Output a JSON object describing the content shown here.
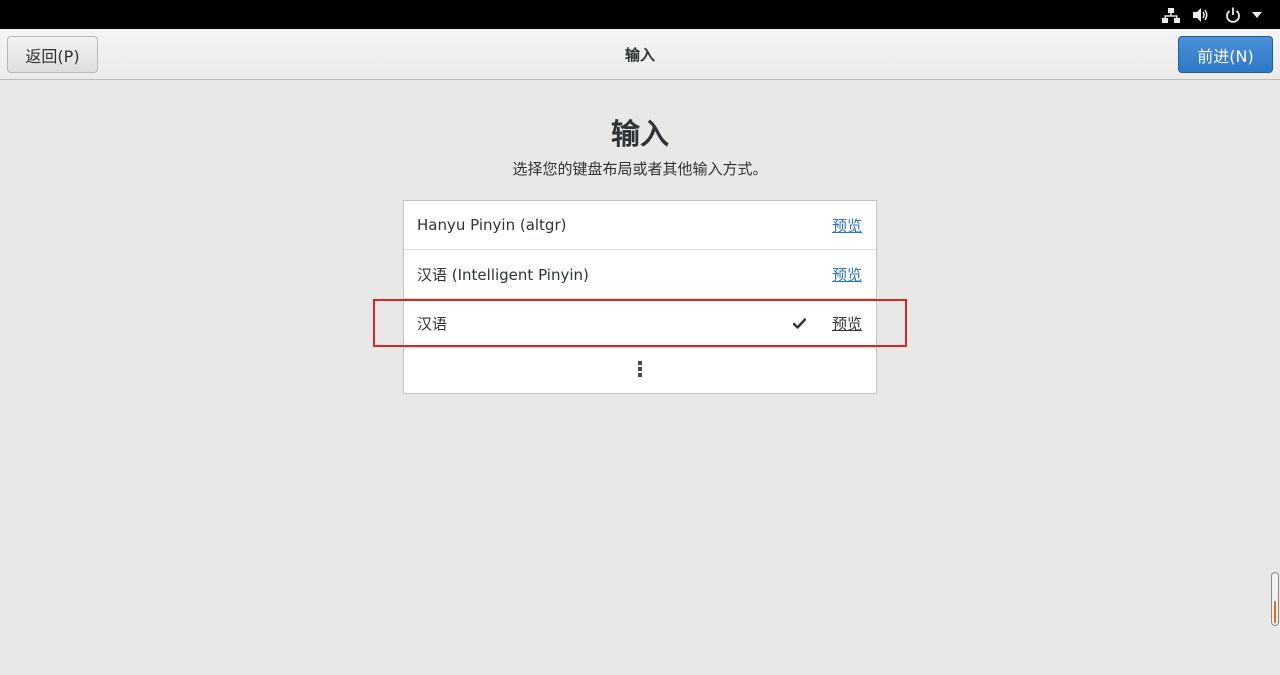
{
  "topbar": {
    "icons": [
      "network-icon",
      "volume-icon",
      "power-icon",
      "menu-arrow-icon"
    ]
  },
  "header": {
    "back_label": "返回(P)",
    "title": "输入",
    "next_label": "前进(N)"
  },
  "page": {
    "title": "输入",
    "subtitle": "选择您的键盘布局或者其他输入方式。"
  },
  "input_sources": [
    {
      "name": "Hanyu Pinyin (altgr)",
      "preview": "预览",
      "selected": false
    },
    {
      "name": "汉语 (Intelligent Pinyin)",
      "preview": "预览",
      "selected": false
    },
    {
      "name": "汉语",
      "preview": "预览",
      "selected": true
    }
  ],
  "colors": {
    "accent": "#2d79c7",
    "link": "#2a76c6",
    "highlight": "#d7262e",
    "background": "#e8e8e7"
  }
}
